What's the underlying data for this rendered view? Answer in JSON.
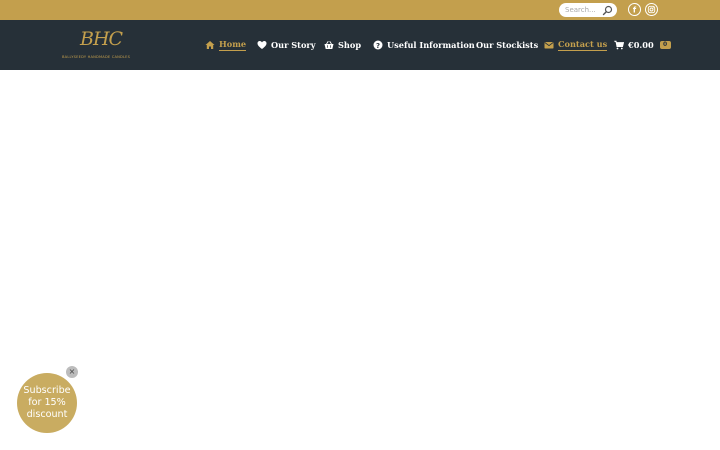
{
  "topbar": {
    "search": {
      "placeholder": "Search...",
      "value": ""
    },
    "social": [
      {
        "icon": "facebook-icon",
        "glyph": "f"
      },
      {
        "icon": "instagram-icon"
      }
    ]
  },
  "logo": {
    "mark": "BHC",
    "subtitle": "BALLYSEEDY HANDMADE CANDLES"
  },
  "nav": {
    "items": [
      {
        "label": "Home",
        "icon": "home-icon",
        "active": true
      },
      {
        "label": "Our Story",
        "icon": "heart-icon",
        "active": false
      },
      {
        "label": "Shop",
        "icon": "basket-icon",
        "active": false
      },
      {
        "label": "Useful Information",
        "icon": "question-circle-icon",
        "active": false
      },
      {
        "label": "Our Stockists",
        "icon": "",
        "active": false
      },
      {
        "label": "Contact us",
        "icon": "envelope-icon",
        "active": false
      }
    ],
    "cart": {
      "total": "€0.00",
      "count": "0",
      "icon": "cart-icon"
    }
  },
  "promo": {
    "text": "Subscribe for 15% discount",
    "close_glyph": "×"
  },
  "colors": {
    "accent": "#c39f4d",
    "nav_bg": "#263038",
    "promo_bg": "#c9ac61"
  }
}
